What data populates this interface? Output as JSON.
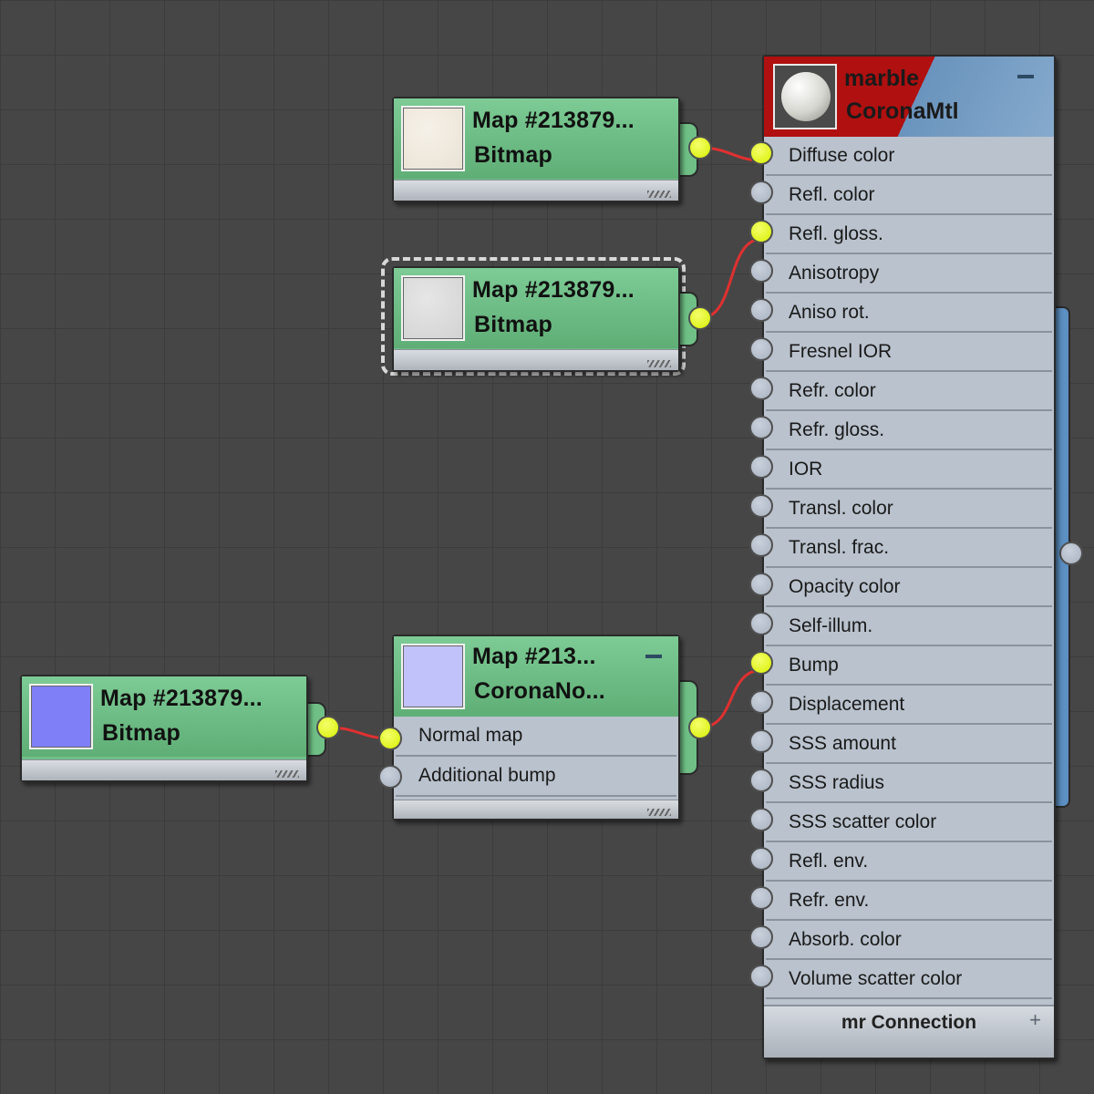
{
  "material_node": {
    "name": "marble",
    "type": "CoronaMtl",
    "params": [
      {
        "label": "Diffuse color",
        "connected": true
      },
      {
        "label": "Refl. color",
        "connected": false
      },
      {
        "label": "Refl. gloss.",
        "connected": true
      },
      {
        "label": "Anisotropy",
        "connected": false
      },
      {
        "label": "Aniso rot.",
        "connected": false
      },
      {
        "label": "Fresnel IOR",
        "connected": false
      },
      {
        "label": "Refr. color",
        "connected": false
      },
      {
        "label": "Refr. gloss.",
        "connected": false
      },
      {
        "label": "IOR",
        "connected": false
      },
      {
        "label": "Transl. color",
        "connected": false
      },
      {
        "label": "Transl. frac.",
        "connected": false
      },
      {
        "label": "Opacity color",
        "connected": false
      },
      {
        "label": "Self-illum.",
        "connected": false
      },
      {
        "label": "Bump",
        "connected": true
      },
      {
        "label": "Displacement",
        "connected": false
      },
      {
        "label": "SSS amount",
        "connected": false
      },
      {
        "label": "SSS radius",
        "connected": false
      },
      {
        "label": "SSS scatter color",
        "connected": false
      },
      {
        "label": "Refl. env.",
        "connected": false
      },
      {
        "label": "Refr. env.",
        "connected": false
      },
      {
        "label": "Absorb. color",
        "connected": false
      },
      {
        "label": "Volume scatter color",
        "connected": false
      }
    ],
    "footer_label": "mr Connection",
    "footer_plus": "+"
  },
  "map_nodes": {
    "diffuse": {
      "title": "Map #213879...",
      "type": "Bitmap"
    },
    "gloss": {
      "title": "Map #213879...",
      "type": "Bitmap",
      "selected": true
    },
    "normal": {
      "title": "Map #213...",
      "type": "CoronaNo...",
      "params": [
        {
          "label": "Normal map",
          "connected": true
        },
        {
          "label": "Additional bump",
          "connected": false
        }
      ]
    },
    "normal_bitmap": {
      "title": "Map #213879...",
      "type": "Bitmap"
    }
  },
  "colors": {
    "canvas_bg": "#464646",
    "map_node_green": "#6fbf86",
    "material_header_red": "#b01010",
    "material_header_blue": "#6a94bd",
    "param_row": "#b9c2cd",
    "socket_connected": "#d7f000",
    "wire": "#e03030"
  }
}
